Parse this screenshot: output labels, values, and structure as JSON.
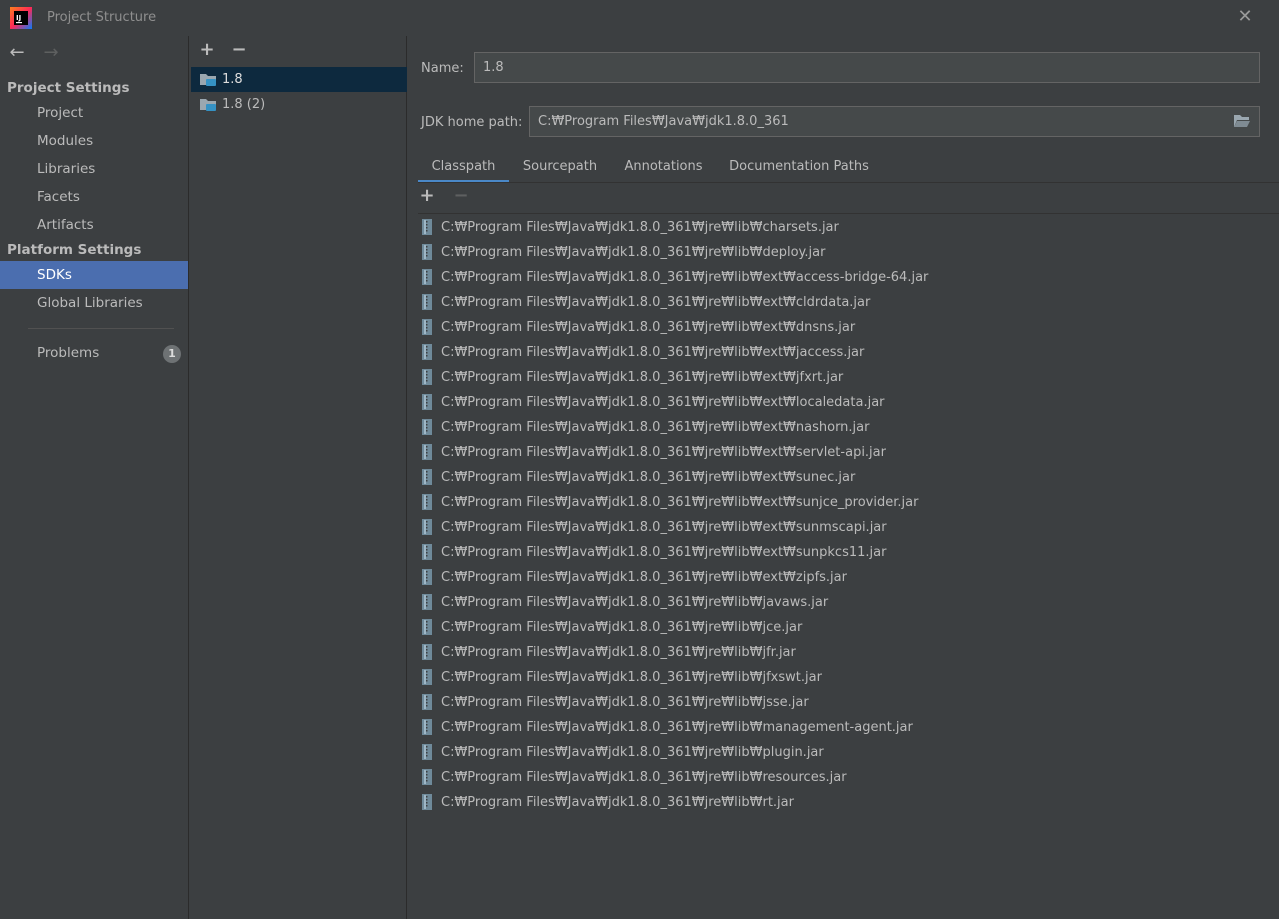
{
  "window": {
    "title": "Project Structure"
  },
  "nav": {
    "project_settings_title": "Project Settings",
    "project_items": [
      "Project",
      "Modules",
      "Libraries",
      "Facets",
      "Artifacts"
    ],
    "platform_settings_title": "Platform Settings",
    "platform_items": [
      "SDKs",
      "Global Libraries"
    ],
    "selected": "SDKs",
    "problems_label": "Problems",
    "problems_count": "1"
  },
  "sdk_list": {
    "items": [
      "1.8",
      "1.8 (2)"
    ],
    "selected": "1.8"
  },
  "detail": {
    "name_label": "Name:",
    "name_value": "1.8",
    "home_label": "JDK home path:",
    "home_value": "C:₩Program Files₩Java₩jdk1.8.0_361",
    "tabs": [
      "Classpath",
      "Sourcepath",
      "Annotations",
      "Documentation Paths"
    ],
    "active_tab": "Classpath",
    "classpath": [
      "C:₩Program Files₩Java₩jdk1.8.0_361₩jre₩lib₩charsets.jar",
      "C:₩Program Files₩Java₩jdk1.8.0_361₩jre₩lib₩deploy.jar",
      "C:₩Program Files₩Java₩jdk1.8.0_361₩jre₩lib₩ext₩access-bridge-64.jar",
      "C:₩Program Files₩Java₩jdk1.8.0_361₩jre₩lib₩ext₩cldrdata.jar",
      "C:₩Program Files₩Java₩jdk1.8.0_361₩jre₩lib₩ext₩dnsns.jar",
      "C:₩Program Files₩Java₩jdk1.8.0_361₩jre₩lib₩ext₩jaccess.jar",
      "C:₩Program Files₩Java₩jdk1.8.0_361₩jre₩lib₩ext₩jfxrt.jar",
      "C:₩Program Files₩Java₩jdk1.8.0_361₩jre₩lib₩ext₩localedata.jar",
      "C:₩Program Files₩Java₩jdk1.8.0_361₩jre₩lib₩ext₩nashorn.jar",
      "C:₩Program Files₩Java₩jdk1.8.0_361₩jre₩lib₩ext₩servlet-api.jar",
      "C:₩Program Files₩Java₩jdk1.8.0_361₩jre₩lib₩ext₩sunec.jar",
      "C:₩Program Files₩Java₩jdk1.8.0_361₩jre₩lib₩ext₩sunjce_provider.jar",
      "C:₩Program Files₩Java₩jdk1.8.0_361₩jre₩lib₩ext₩sunmscapi.jar",
      "C:₩Program Files₩Java₩jdk1.8.0_361₩jre₩lib₩ext₩sunpkcs11.jar",
      "C:₩Program Files₩Java₩jdk1.8.0_361₩jre₩lib₩ext₩zipfs.jar",
      "C:₩Program Files₩Java₩jdk1.8.0_361₩jre₩lib₩javaws.jar",
      "C:₩Program Files₩Java₩jdk1.8.0_361₩jre₩lib₩jce.jar",
      "C:₩Program Files₩Java₩jdk1.8.0_361₩jre₩lib₩jfr.jar",
      "C:₩Program Files₩Java₩jdk1.8.0_361₩jre₩lib₩jfxswt.jar",
      "C:₩Program Files₩Java₩jdk1.8.0_361₩jre₩lib₩jsse.jar",
      "C:₩Program Files₩Java₩jdk1.8.0_361₩jre₩lib₩management-agent.jar",
      "C:₩Program Files₩Java₩jdk1.8.0_361₩jre₩lib₩plugin.jar",
      "C:₩Program Files₩Java₩jdk1.8.0_361₩jre₩lib₩resources.jar",
      "C:₩Program Files₩Java₩jdk1.8.0_361₩jre₩lib₩rt.jar"
    ]
  },
  "icons": {
    "app": "intellij-idea-icon",
    "close": "close-icon",
    "back": "arrow-left-icon",
    "forward": "arrow-right-icon",
    "add": "plus-icon",
    "remove": "minus-icon",
    "sdk": "jdk-folder-icon",
    "browse": "folder-open-icon",
    "jar": "jar-archive-icon"
  },
  "colors": {
    "background": "#3c3f41",
    "selection_nav": "#4b6eaf",
    "selection_list": "#0d293e",
    "text": "#bbbbbb",
    "tab_accent": "#4a88c7",
    "input_bg": "#45494a"
  }
}
